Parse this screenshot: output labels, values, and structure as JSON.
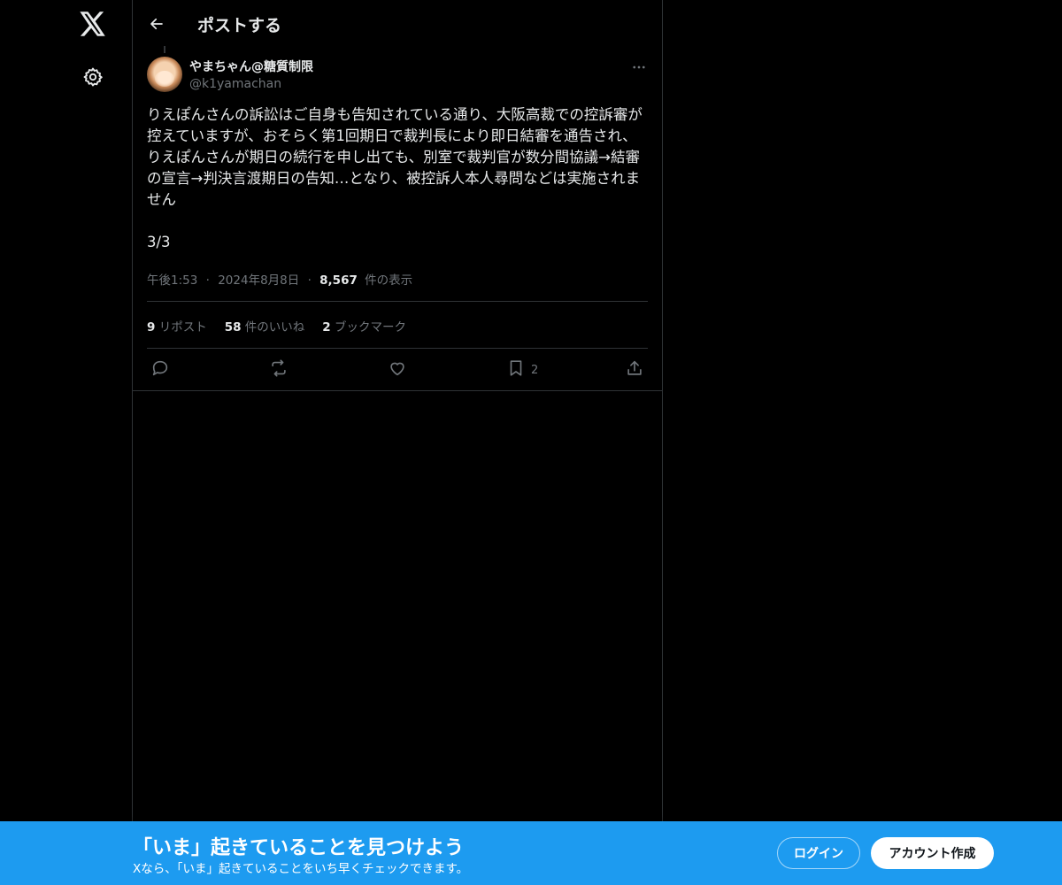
{
  "header": {
    "title": "ポストする"
  },
  "tweet": {
    "author_name": "やまちゃん@糖質制限",
    "author_handle": "@k1yamachan",
    "text": "りえぽんさんの訴訟はご自身も告知されている通り、大阪高裁での控訴審が控えていますが、おそらく第1回期日で裁判長により即日結審を通告され、りえぽんさんが期日の続行を申し出ても、別室で裁判官が数分間協議→結審の宣言→判決言渡期日の告知…となり、被控訴人本人尋問などは実施されません\n\n3/3",
    "time": "午後1:53",
    "date": "2024年8月8日",
    "separator": "·",
    "views_count": "8,567",
    "views_label": "件の表示"
  },
  "stats": {
    "reposts_count": "9",
    "reposts_label": "リポスト",
    "likes_count": "58",
    "likes_label": "件のいいね",
    "bookmarks_count": "2",
    "bookmarks_label": "ブックマーク"
  },
  "actions": {
    "bookmark_count": "2"
  },
  "banner": {
    "title": "「いま」起きていることを見つけよう",
    "subtitle": "Xなら、「いま」起きていることをいち早くチェックできます。",
    "login_label": "ログイン",
    "signup_label": "アカウント作成"
  },
  "colors": {
    "background": "#000000",
    "text_primary": "#e7e9ea",
    "text_secondary": "#71767b",
    "border": "#2f3336",
    "accent": "#1d9bf0"
  },
  "icons": [
    "x-logo-icon",
    "gear-icon",
    "back-arrow-icon",
    "more-icon",
    "reply-icon",
    "repost-icon",
    "like-icon",
    "bookmark-icon",
    "share-icon"
  ]
}
